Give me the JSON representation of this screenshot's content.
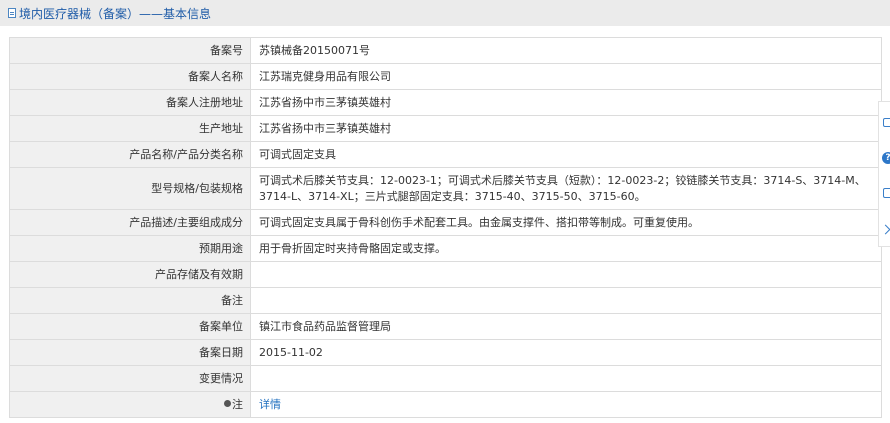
{
  "header": {
    "title": "境内医疗器械（备案）——基本信息",
    "icon": "document-icon"
  },
  "table": {
    "rows": [
      {
        "label": "备案号",
        "value": "苏镇械备20150071号"
      },
      {
        "label": "备案人名称",
        "value": "江苏瑞克健身用品有限公司"
      },
      {
        "label": "备案人注册地址",
        "value": "江苏省扬中市三茅镇英雄村"
      },
      {
        "label": "生产地址",
        "value": "江苏省扬中市三茅镇英雄村"
      },
      {
        "label": "产品名称/产品分类名称",
        "value": "可调式固定支具"
      },
      {
        "label": "型号规格/包装规格",
        "value": "可调式术后膝关节支具：12-0023-1；可调式术后膝关节支具（短款）：12-0023-2；铰链膝关节支具：3714-S、3714-M、3714-L、3714-XL；三片式腿部固定支具：3715-40、3715-50、3715-60。"
      },
      {
        "label": "产品描述/主要组成成分",
        "value": "可调式固定支具属于骨科创伤手术配套工具。由金属支撑件、搭扣带等制成。可重复使用。"
      },
      {
        "label": "预期用途",
        "value": "用于骨折固定时夹持骨骼固定或支撑。"
      },
      {
        "label": "产品存储及有效期",
        "value": ""
      },
      {
        "label": "备注",
        "value": ""
      },
      {
        "label": "备案单位",
        "value": "镇江市食品药品监督管理局"
      },
      {
        "label": "备案日期",
        "value": "2015-11-02"
      },
      {
        "label": "变更情况",
        "value": ""
      },
      {
        "label": "注",
        "value": "详情"
      }
    ]
  },
  "side_toolbar": {
    "icons": [
      "share-icon",
      "help-icon",
      "copy-icon",
      "chevron-right-icon"
    ]
  },
  "colors": {
    "header_bg": "#ebebeb",
    "title_blue": "#1f5ca8",
    "label_bg": "#f0f0f0",
    "border": "#dcdcdc",
    "link": "#1f6fbf"
  }
}
